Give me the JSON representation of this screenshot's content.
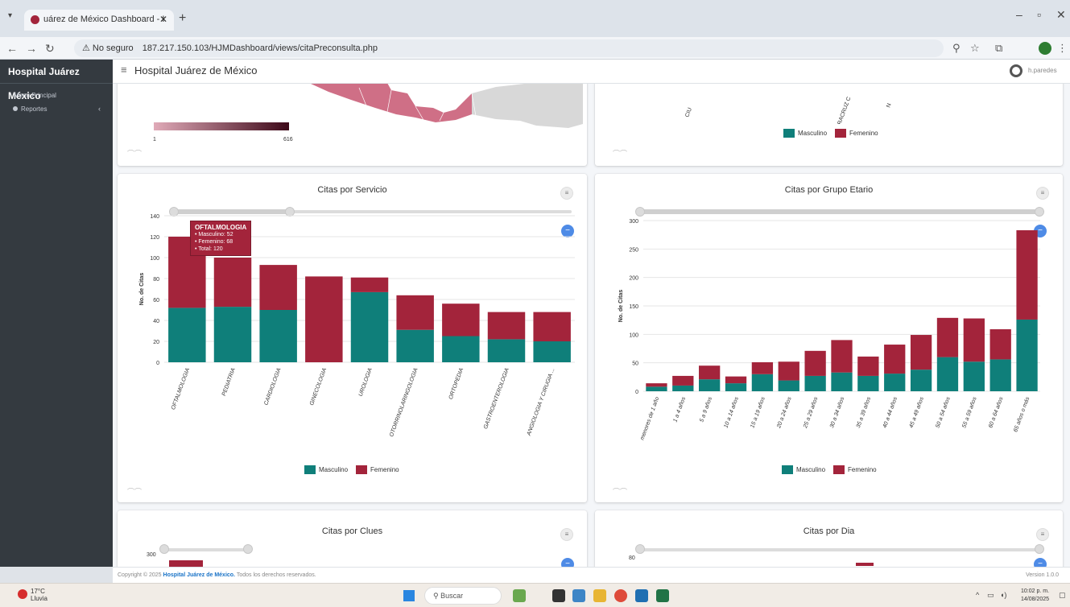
{
  "browser": {
    "tab_title": "uárez de México Dashboard - I",
    "url_warning": "No seguro",
    "url": "187.217.150.103/HJMDashboard/views/citaPreconsulta.php"
  },
  "sidebar": {
    "brand": "Hospital Juárez México",
    "menu_title": "Menú Principal",
    "items": [
      {
        "label": "Reportes"
      }
    ]
  },
  "header": {
    "title": "Hospital Juárez de México",
    "user": "h.paredes"
  },
  "colors": {
    "masculino": "#0f7f7a",
    "femenino": "#a3243b"
  },
  "map_card": {
    "scale_min": "1",
    "scale_max": "616"
  },
  "states_card": {
    "labels": [
      "CIU",
      "VERACRUZ C",
      "N"
    ],
    "legend": [
      "Masculino",
      "Femenino"
    ]
  },
  "servicio_chart": {
    "title": "Citas por Servicio",
    "ylabel": "No. de Citas",
    "tooltip": {
      "title": "OFTALMOLOGIA",
      "lines": [
        "• Masculino: 52",
        "• Femenino: 68",
        "• Total: 120"
      ]
    },
    "legend": [
      "Masculino",
      "Femenino"
    ]
  },
  "etario_chart": {
    "title": "Citas por Grupo Etario",
    "ylabel": "No. de Citas",
    "legend": [
      "Masculino",
      "Femenino"
    ]
  },
  "clues_card": {
    "title": "Citas por Clues",
    "ytick": "300"
  },
  "dia_card": {
    "title": "Citas por Dia",
    "ytick": "80"
  },
  "chart_data": [
    {
      "type": "bar",
      "title": "Citas por Servicio",
      "ylabel": "No. de Citas",
      "ylim": [
        0,
        140
      ],
      "yticks": [
        0,
        20,
        40,
        60,
        80,
        100,
        120,
        140
      ],
      "categories": [
        "OFTALMOLOGIA",
        "PEDIATRIA",
        "CARDIOLOGIA",
        "GINECOLOGIA",
        "UROLOGIA",
        "OTORRINOLARINGOLOGIA",
        "ORTOPEDIA",
        "GASTROENTEROLOGIA",
        "ANGIOLOGIA Y CIRUGIA ..."
      ],
      "series": [
        {
          "name": "Masculino",
          "values": [
            52,
            53,
            50,
            0,
            67,
            31,
            25,
            22,
            20
          ]
        },
        {
          "name": "Femenino",
          "values": [
            68,
            47,
            43,
            82,
            14,
            33,
            31,
            26,
            28
          ]
        }
      ],
      "stacked": true,
      "legend": "bottom"
    },
    {
      "type": "bar",
      "title": "Citas por Grupo Etario",
      "ylabel": "No. de Citas",
      "ylim": [
        0,
        300
      ],
      "yticks": [
        0,
        50,
        100,
        150,
        200,
        250,
        300
      ],
      "categories": [
        "menores de 1 año",
        "1 a 4 años",
        "5 a 9 años",
        "10 a 14 años",
        "15 a 19 años",
        "20 a 24 años",
        "25 a 29 años",
        "30 a 34 años",
        "35 a 39 años",
        "40 a 44 años",
        "45 a 49 años",
        "50 a 54 años",
        "55 a 59 años",
        "60 a 64 años",
        "65 años o más"
      ],
      "series": [
        {
          "name": "Masculino",
          "values": [
            8,
            10,
            21,
            14,
            30,
            19,
            27,
            33,
            27,
            31,
            38,
            60,
            52,
            56,
            126
          ]
        },
        {
          "name": "Femenino",
          "values": [
            6,
            17,
            24,
            12,
            21,
            33,
            44,
            57,
            34,
            51,
            61,
            69,
            76,
            53,
            157
          ]
        }
      ],
      "stacked": true,
      "legend": "bottom"
    }
  ],
  "footer": {
    "copyright_prefix": "Copyright © 2025",
    "org": "Hospital Juárez de México.",
    "rights": "Todos los derechos reservados.",
    "version": "Version 1.0.0"
  },
  "taskbar": {
    "temp": "17°C",
    "weather": "Lluvia",
    "search": "Buscar",
    "time": "10:02 p. m.",
    "date": "14/08/2025"
  }
}
